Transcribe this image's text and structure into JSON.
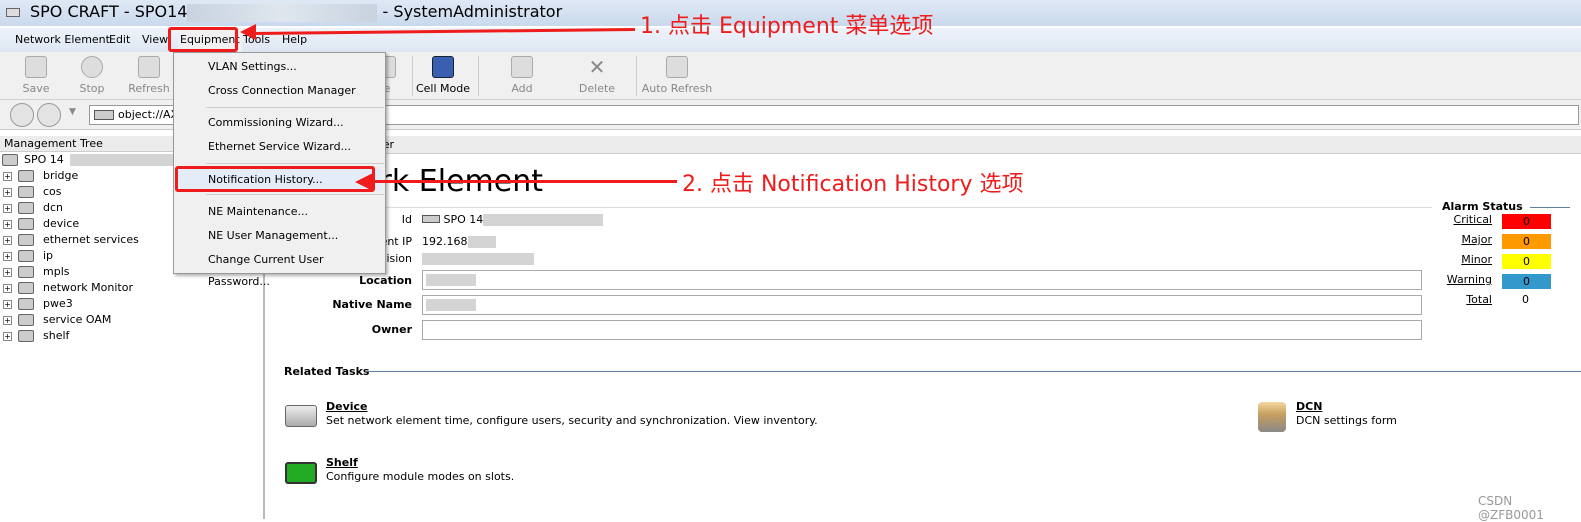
{
  "window": {
    "title_prefix": "SPO CRAFT - SPO14",
    "title_suffix": " - SystemAdministrator"
  },
  "menubar": [
    "Network Element",
    "Edit",
    "View",
    "Equipment",
    "Tools",
    "Help"
  ],
  "toolbar": [
    "Save",
    "Stop",
    "Refresh",
    "te",
    "Cell Mode",
    "Add",
    "Delete",
    "Auto Refresh"
  ],
  "address": {
    "value": "object://AX"
  },
  "equipment_menu": [
    "VLAN Settings...",
    "Cross Connection Manager",
    "Commissioning Wizard...",
    "Ethernet Service Wizard...",
    "Notification History...",
    "NE Maintenance...",
    "NE User Management...",
    "Change Current User Password..."
  ],
  "tree": {
    "header": "Management Tree",
    "root": "SPO 14",
    "items": [
      "bridge",
      "cos",
      "dcn",
      "device",
      "ethernet services",
      "ip",
      "mpls",
      "network Monitor",
      "pwe3",
      "service OAM",
      "shelf"
    ]
  },
  "browser": {
    "header": "wser",
    "title": "Network Element"
  },
  "properties": {
    "id_label": "Id",
    "id_value": "SPO 14",
    "ip_label": "Management IP",
    "ip_value": "192.168",
    "revision_label": "Revision",
    "location_label": "Location",
    "native_label": "Native Name",
    "owner_label": "Owner"
  },
  "alarm": {
    "title": "Alarm Status",
    "items": [
      {
        "label": "Critical",
        "value": "0",
        "color": "#ff0000"
      },
      {
        "label": "Major",
        "value": "0",
        "color": "#ff9900"
      },
      {
        "label": "Minor",
        "value": "0",
        "color": "#ffff00"
      },
      {
        "label": "Warning",
        "value": "0",
        "color": "#3399cc"
      }
    ],
    "total_label": "Total",
    "total_value": "0"
  },
  "related": {
    "title": "Related Tasks",
    "tasks": [
      {
        "name": "Device",
        "desc": "Set network element time, configure users, security and synchronization. View inventory."
      },
      {
        "name": "DCN",
        "desc": "DCN settings form"
      },
      {
        "name": "Shelf",
        "desc": "Configure module modes on slots."
      }
    ]
  },
  "annotations": [
    "1. 点击 Equipment 菜单选项",
    "2. 点击 Notification History 选项"
  ],
  "watermark": "CSDN @ZFB0001"
}
